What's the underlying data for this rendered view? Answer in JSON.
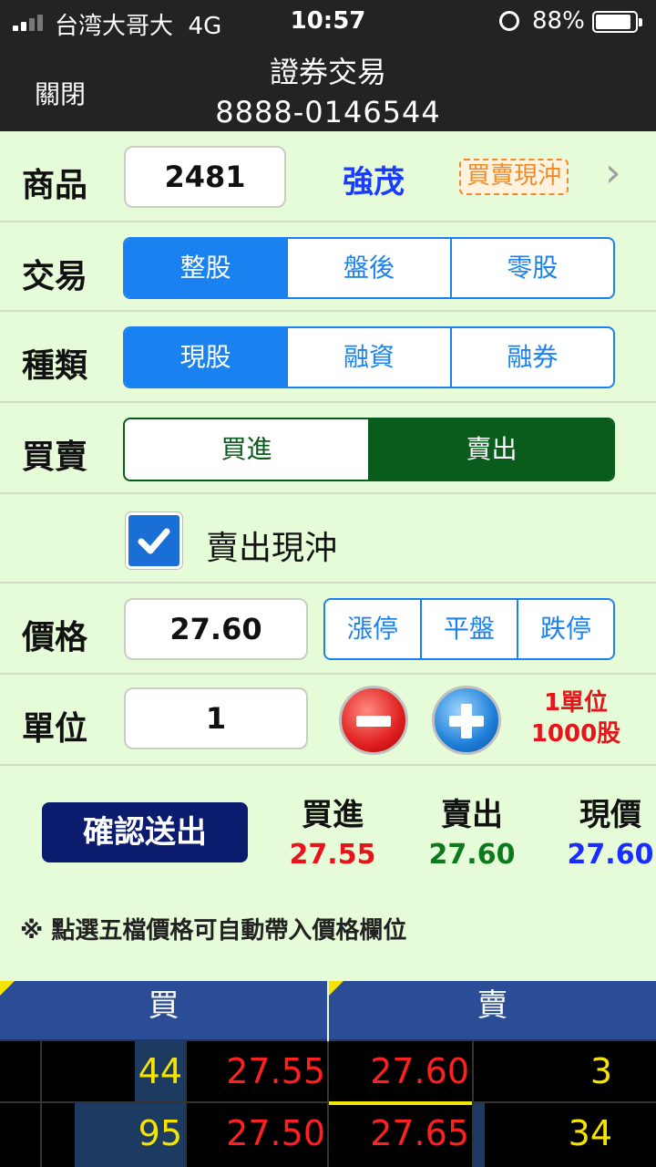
{
  "status": {
    "carrier": "台湾大哥大",
    "network": "4G",
    "time": "10:57",
    "battery": "88%"
  },
  "nav": {
    "close": "關閉",
    "title": "證券交易",
    "account": "8888-0146544"
  },
  "product": {
    "label": "商品",
    "code": "2481",
    "name": "強茂",
    "tag": "買賣現沖",
    "chevron": "›"
  },
  "trade": {
    "label": "交易",
    "options": [
      "整股",
      "盤後",
      "零股"
    ],
    "selected": "整股"
  },
  "type": {
    "label": "種類",
    "options": [
      "現股",
      "融資",
      "融券"
    ],
    "selected": "現股"
  },
  "side": {
    "label": "買賣",
    "options": [
      "買進",
      "賣出"
    ],
    "selected": "賣出"
  },
  "daytrade": {
    "checked": true,
    "label": "賣出現沖"
  },
  "price": {
    "label": "價格",
    "value": "27.60",
    "options": [
      "漲停",
      "平盤",
      "跌停"
    ]
  },
  "unit": {
    "label": "單位",
    "value": "1",
    "note_line1": "1單位",
    "note_line2": "1000股"
  },
  "submit": {
    "label": "確認送出"
  },
  "quote": {
    "bid_label": "買進",
    "bid": "27.55",
    "ask_label": "賣出",
    "ask": "27.60",
    "last_label": "現價",
    "last": "27.60"
  },
  "hint": "※ 點選五檔價格可自動帶入價格欄位",
  "book": {
    "buy_header": "買",
    "sell_header": "賣",
    "rows": [
      {
        "bid_qty": "44",
        "bid_price": "27.55",
        "ask_price": "27.60",
        "ask_qty": "3"
      },
      {
        "bid_qty": "95",
        "bid_price": "27.50",
        "ask_price": "27.65",
        "ask_qty": "34"
      }
    ]
  },
  "colors": {
    "blue": "#1a82f0",
    "green": "#0a5c1c",
    "red": "#e8141b",
    "navy": "#0b1b6e",
    "book_header": "#2b4d98"
  }
}
